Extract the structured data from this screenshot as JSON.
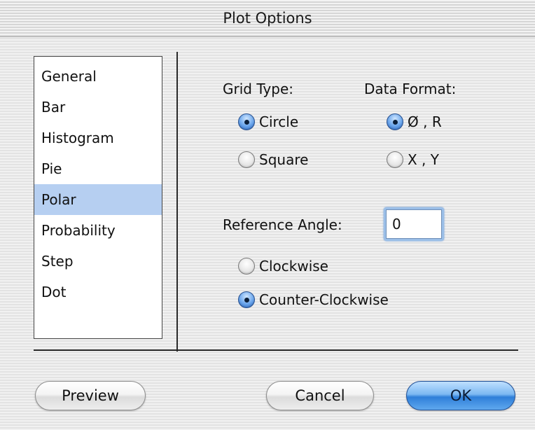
{
  "window": {
    "title": "Plot Options"
  },
  "plot_types": [
    {
      "label": "General",
      "selected": false
    },
    {
      "label": "Bar",
      "selected": false
    },
    {
      "label": "Histogram",
      "selected": false
    },
    {
      "label": "Pie",
      "selected": false
    },
    {
      "label": "Polar",
      "selected": true
    },
    {
      "label": "Probability",
      "selected": false
    },
    {
      "label": "Step",
      "selected": false
    },
    {
      "label": "Dot",
      "selected": false
    }
  ],
  "grid_type": {
    "label": "Grid Type:",
    "options": [
      {
        "label": "Circle",
        "checked": true
      },
      {
        "label": "Square",
        "checked": false
      }
    ]
  },
  "data_format": {
    "label": "Data Format:",
    "options": [
      {
        "label": "Ø , R",
        "checked": true
      },
      {
        "label": "X , Y",
        "checked": false
      }
    ]
  },
  "reference_angle": {
    "label": "Reference Angle:",
    "value": "0"
  },
  "direction": {
    "options": [
      {
        "label": "Clockwise",
        "checked": false
      },
      {
        "label": "Counter-Clockwise",
        "checked": true
      }
    ]
  },
  "buttons": {
    "preview": "Preview",
    "cancel": "Cancel",
    "ok": "OK"
  },
  "colors": {
    "selection": "#b6cff1",
    "default_button": "#3b86dd",
    "radio_checked": "#2a67c4"
  }
}
